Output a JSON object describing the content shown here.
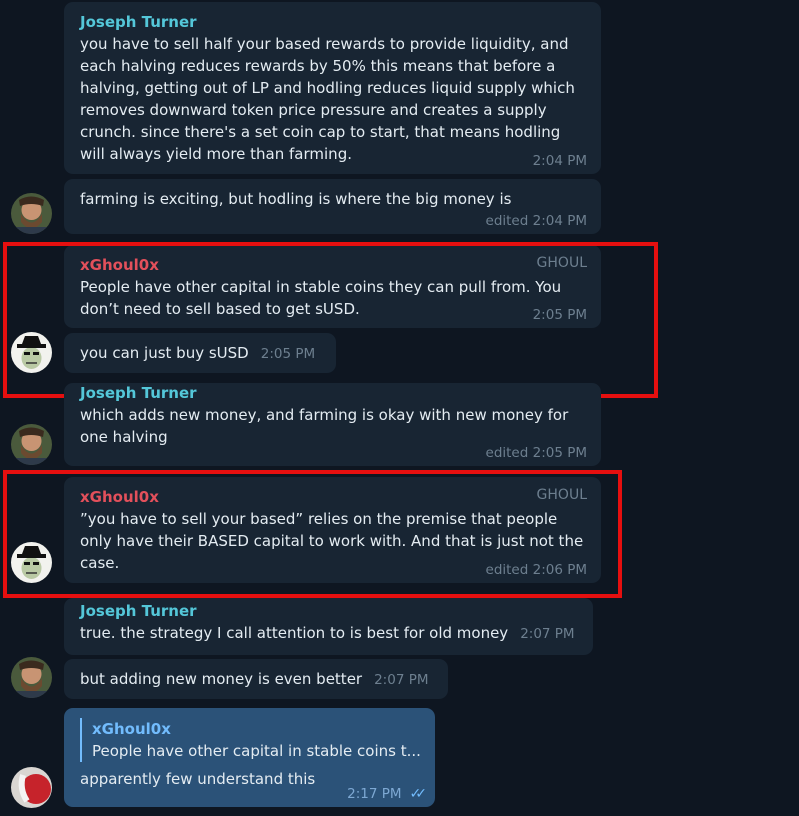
{
  "messages": {
    "m1": {
      "sender": "Joseph Turner",
      "text": "you have to sell half your based rewards to provide liquidity, and each halving reduces rewards by 50% this means that before a halving, getting out of LP and hodling reduces liquid supply which removes downward token price pressure and creates a supply crunch. since there's a set coin cap to start, that means hodling will always yield more than farming.",
      "time": "2:04 PM"
    },
    "m2": {
      "text": "farming is exciting, but hodling is where the big money is",
      "time": "edited 2:04 PM"
    },
    "m3": {
      "sender": "xGhoul0x",
      "tag": "GHOUL",
      "text": "People have other capital in stable coins they can pull from. You don’t need to sell based to get sUSD.",
      "time": "2:05 PM"
    },
    "m4": {
      "text": "you can just buy sUSD",
      "time": "2:05 PM"
    },
    "m5": {
      "sender": "Joseph Turner",
      "text": "which adds new money, and farming is okay with new money for one halving",
      "time": "edited 2:05 PM"
    },
    "m6": {
      "sender": "xGhoul0x",
      "tag": "GHOUL",
      "text": "”you have to sell your based” relies on the premise that people only have their BASED capital to work with. And that is just not the case.",
      "time": "edited 2:06 PM"
    },
    "m7": {
      "sender": "Joseph Turner",
      "text": "true. the strategy I call attention to is best for old money",
      "time": "2:07 PM"
    },
    "m8": {
      "text": "but adding new money is even better",
      "time": "2:07 PM"
    },
    "m9": {
      "reply_sender": "xGhoul0x",
      "reply_text": "People have other capital in stable coins t...",
      "text": "apparently few understand this",
      "time": "2:17 PM",
      "status_icon": "double-check-icon"
    }
  },
  "avatars": {
    "turner": "bearded-man-avatar",
    "ghoul": "ghoul-cartoon-avatar",
    "self": "red-ball-avatar"
  },
  "colors": {
    "background": "#0e1621",
    "bubble_in": "#182533",
    "bubble_out": "#2b5278",
    "name_turner": "#54c7d9",
    "name_ghoul": "#e3505b",
    "highlight": "#e60f0f"
  }
}
